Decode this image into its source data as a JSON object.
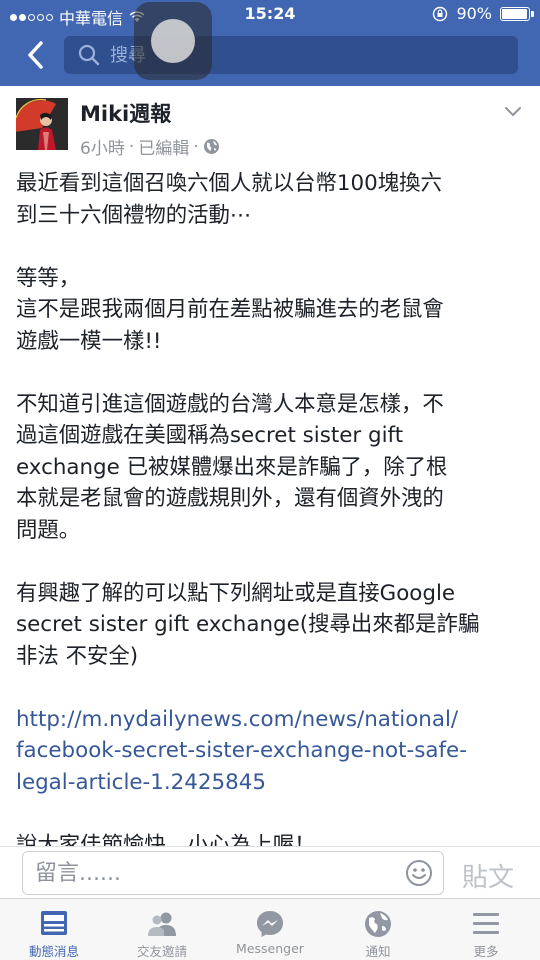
{
  "status": {
    "carrier": "中華電信",
    "time": "15:24",
    "battery_text": "90%",
    "battery_level": 0.9
  },
  "header": {
    "search_placeholder": "搜尋"
  },
  "post": {
    "author": "Miki週報",
    "time": "6小時",
    "edited": "已編輯",
    "paragraphs": [
      [
        "最近看到這個召喚六個人就以台幣100塊換六",
        "到三十六個禮物的活動⋯"
      ],
      [
        "等等，",
        "這不是跟我兩個月前在差點被騙進去的老鼠會",
        "遊戲一模一樣!!"
      ],
      [
        "不知道引進這個遊戲的台灣人本意是怎樣，不",
        "過這個遊戲在美國稱為secret sister gift",
        "exchange 已被媒體爆出來是詐騙了，除了根",
        "本就是老鼠會的遊戲規則外，還有個資外洩的",
        "問題。"
      ],
      [
        "有興趣了解的可以點下列網址或是直接Google",
        "secret sister gift exchange(搜尋出來都是詐騙",
        "非法 不安全)"
      ]
    ],
    "link_lines": [
      "http://m.nydailynews.com/news/national/",
      "facebook-secret-sister-exchange-not-safe-",
      "legal-article-1.2425845"
    ],
    "trailing_line": "說大家佳節愉快，小心為上喔！"
  },
  "comment": {
    "placeholder": "留言......",
    "post_label": "貼文"
  },
  "tabs": [
    {
      "label": "動態消息",
      "icon": "news-feed-icon",
      "active": true
    },
    {
      "label": "交友邀請",
      "icon": "friend-requests-icon",
      "active": false
    },
    {
      "label": "Messenger",
      "icon": "messenger-icon",
      "active": false
    },
    {
      "label": "通知",
      "icon": "notifications-globe-icon",
      "active": false
    },
    {
      "label": "更多",
      "icon": "menu-icon",
      "active": false
    }
  ],
  "colors": {
    "brand": "#4267b2",
    "link": "#365899",
    "muted": "#90949c"
  }
}
